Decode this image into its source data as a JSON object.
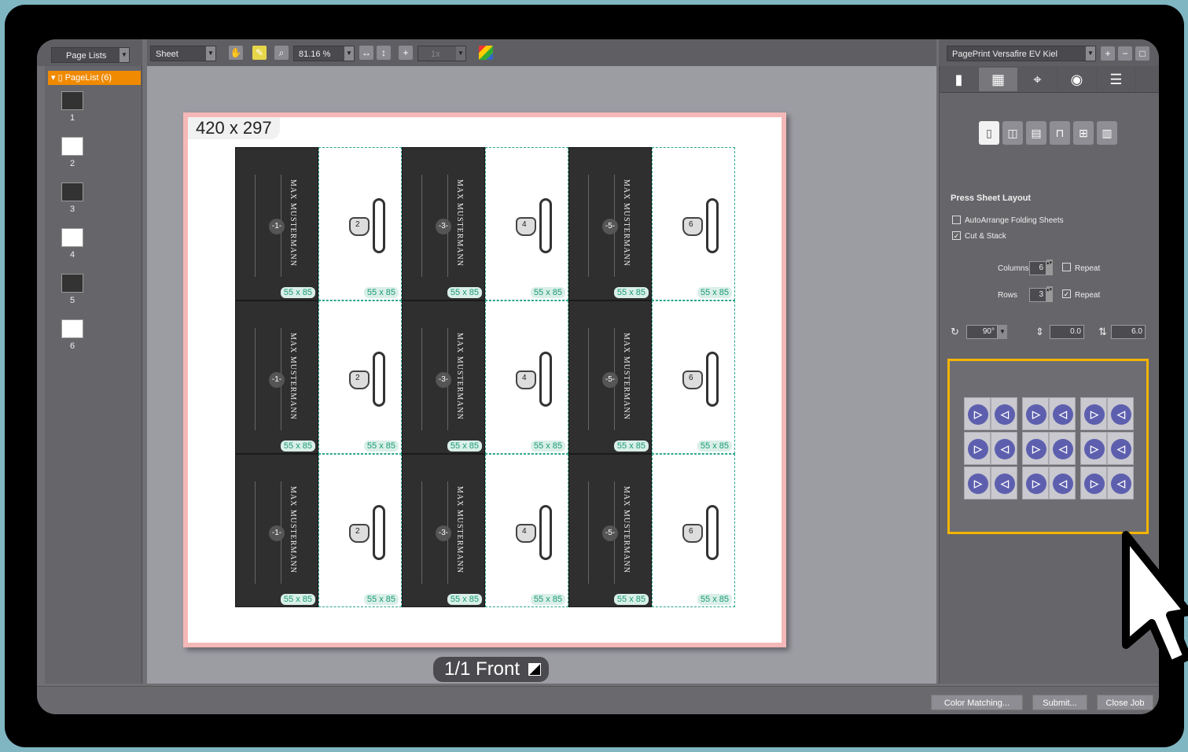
{
  "left_panel": {
    "dropdown_label": "Page Lists",
    "tree_root_label": "PageList (6)",
    "pages": [
      "1",
      "2",
      "3",
      "4",
      "5",
      "6"
    ]
  },
  "toolbar": {
    "view_select": "Sheet",
    "zoom_value": "81.16 %",
    "multiplier": "1x"
  },
  "sheet": {
    "size_label": "420 x 297",
    "card_size_label": "55 x 85",
    "card_name": "MAX MUSTERMANN",
    "page_label": "1/1 Front"
  },
  "right_panel": {
    "device_select": "PagePrint Versafire EV Kiel",
    "section_title": "Press Sheet Layout",
    "autoarrange_label": "AutoArrange Folding Sheets",
    "cut_stack_label": "Cut & Stack",
    "columns_label": "Columns",
    "columns_value": "6",
    "rows_label": "Rows",
    "rows_value": "3",
    "repeat_label": "Repeat",
    "rotation_value": "90°",
    "gap_value": "0.0",
    "offset_value": "6.0"
  },
  "bottom": {
    "color_matching": "Color Matching...",
    "submit": "Submit...",
    "close_job": "Close Job"
  },
  "colors": {
    "highlight": "#f4b400",
    "size_text": "#1a9a74"
  }
}
